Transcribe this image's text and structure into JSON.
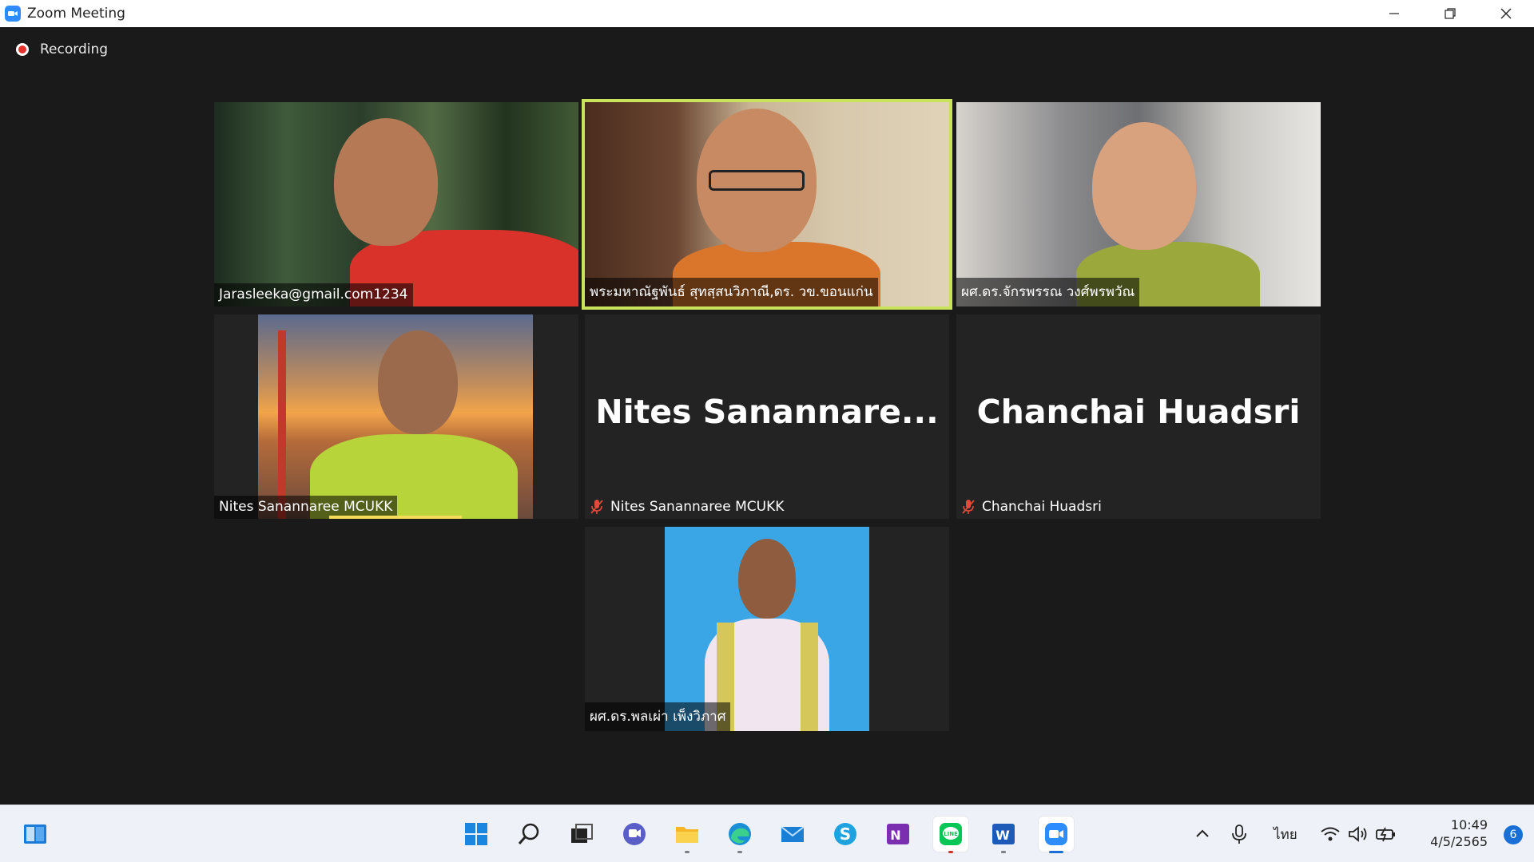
{
  "window": {
    "title": "Zoom Meeting"
  },
  "recording": {
    "label": "Recording"
  },
  "participants": [
    {
      "name": "Jarasleeka@gmail.com1234",
      "video": true
    },
    {
      "name": "พระมหาณัฐพันธ์ สุทสฺสนวิภาณี,ดร. วข.ขอนแก่น",
      "video": true,
      "active_speaker": true
    },
    {
      "name": "ผศ.ดร.จักรพรรณ วงศ์พรพวัณ",
      "video": true
    },
    {
      "name": "Nites Sanannaree MCUKK",
      "video": true,
      "speaking": true
    },
    {
      "name": "Nites Sanannaree MCUKK",
      "display_name": "Nites  Sanannare...",
      "video": false,
      "muted": true
    },
    {
      "name": "Chanchai Huadsri",
      "display_name": "Chanchai Huadsri",
      "video": false,
      "muted": true
    },
    {
      "name": "ผศ.ดร.พลเผ่า เพ็งวิภาศ",
      "video": true
    }
  ],
  "taskbar": {
    "apps": [
      "start-icon",
      "search-icon",
      "task-view-icon",
      "teams-chat-icon",
      "file-explorer-icon",
      "edge-icon",
      "mail-icon",
      "skype-icon",
      "onenote-icon",
      "line-icon",
      "word-icon",
      "zoom-icon"
    ],
    "tray": {
      "language": "ไทย",
      "time": "10:49",
      "date": "4/5/2565",
      "notifications": "6"
    }
  },
  "colors": {
    "active_speaker_border": "#c9e35a",
    "speaking_bar": "#f5dd5a",
    "recording_dot": "#e5312c",
    "taskbar_accent": "#1a6fd6"
  }
}
